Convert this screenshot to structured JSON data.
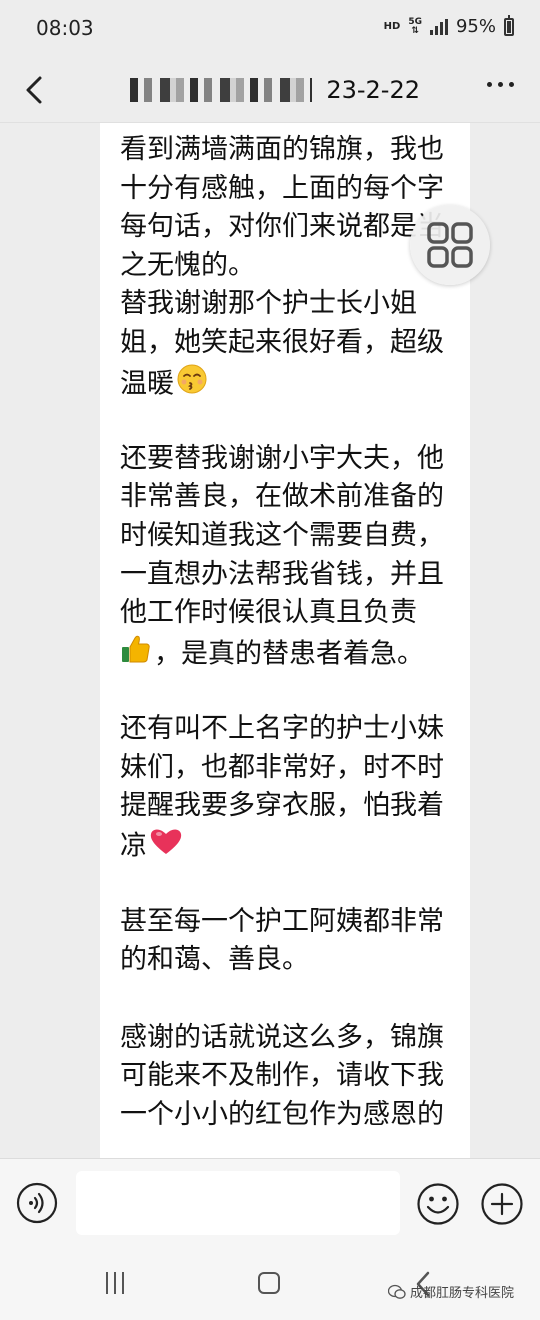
{
  "status_bar": {
    "time": "08:03",
    "hd": "HD",
    "network_top": "5G",
    "network_bottom": "⇅",
    "battery": "95%"
  },
  "nav": {
    "title_visible": "23-2-22"
  },
  "message": {
    "lines": [
      "看到满墙满面的锦旗，我也",
      "十分有感触，上面的每个字",
      "每句话，对你们来说都是当",
      "之无愧的。",
      "替我谢谢那个护士长小姐",
      "姐，她笑起来很好看，超级",
      "温暖",
      "",
      "还要替我谢谢小宇大夫，他",
      "非常善良，在做术前准备的",
      "时候知道我这个需要自费，",
      "一直想办法帮我省钱，并且",
      "他工作时候很认真且负责",
      "，是真的替患者着急。",
      "",
      "还有叫不上名字的护士小妹",
      "妹们，也都非常好，时不时",
      "提醒我要多穿衣服，怕我着",
      "凉",
      "",
      "甚至每一个护工阿姨都非常",
      "的和蔼、善良。",
      "",
      "感谢的话就说这么多，锦旗",
      "可能来不及制作，请收下我",
      "一个小小的红包作为感恩的"
    ],
    "emojis": {
      "line6": "kissing-smiling-eyes-emoji",
      "line13": "thumbs-up-emoji",
      "line18": "red-heart-emoji"
    }
  },
  "input": {
    "placeholder": ""
  },
  "watermark": {
    "text": "成都肛肠专科医院"
  },
  "colors": {
    "background": "#ededed",
    "bubble": "#ffffff",
    "text": "#111111",
    "heart": "#e8325a",
    "thumb": "#f4b400"
  }
}
